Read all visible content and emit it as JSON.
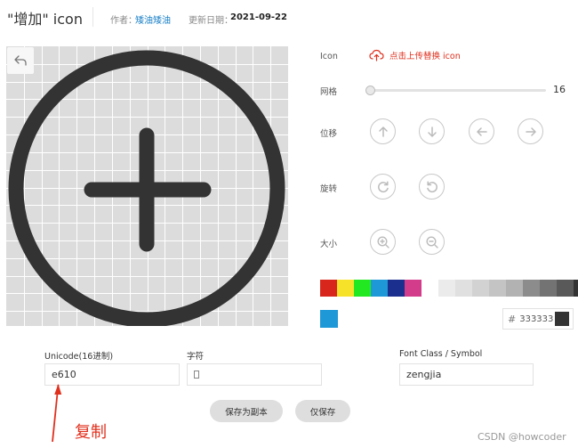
{
  "header": {
    "title": "\"增加\"  icon",
    "author_label": "作者：",
    "author_name": "矮油矮油",
    "updated_label": "更新日期：",
    "updated_date": "2021-09-22"
  },
  "canvas": {
    "icon": "plus-circle-icon",
    "undo_icon": "undo-icon",
    "icon_color": "#333333"
  },
  "controls": {
    "icon_label": "Icon",
    "upload_text": "点击上传替换 icon",
    "grid_label": "网格",
    "grid_value": "16",
    "grid_fraction": 0.0,
    "move_label": "位移",
    "rotate_label": "旋转",
    "size_label": "大小",
    "move_icons": [
      "arrow-up-icon",
      "arrow-down-icon",
      "arrow-left-icon",
      "arrow-right-icon"
    ],
    "rotate_icons": [
      "rotate-cw-icon",
      "rotate-ccw-icon"
    ],
    "size_icons": [
      "zoom-in-icon",
      "zoom-out-icon"
    ]
  },
  "palette": {
    "colors": [
      "#d9261c",
      "#f7e22a",
      "#21e820",
      "#1e98d7",
      "#1b2f8f",
      "#d23c8b",
      "#ffffff",
      "#ebebeb",
      "#e0e0e0",
      "#d2d2d2",
      "#c4c4c4",
      "#b2b2b2",
      "#8c8c8c",
      "#737373",
      "#595959",
      "#333333"
    ],
    "current_color": "#1e98d7",
    "hex_prefix": "#",
    "hex_value": "333333"
  },
  "fields": {
    "unicode_label": "Unicode(16进制)",
    "unicode_value": "e610",
    "char_label": "字符",
    "char_value": "",
    "fontclass_label": "Font Class / Symbol",
    "fontclass_value": "zengjia"
  },
  "buttons": {
    "save_copy": "保存为副本",
    "save_only": "仅保存"
  },
  "annotation": {
    "copy_note": "复制"
  },
  "watermark": "CSDN @howcoder"
}
